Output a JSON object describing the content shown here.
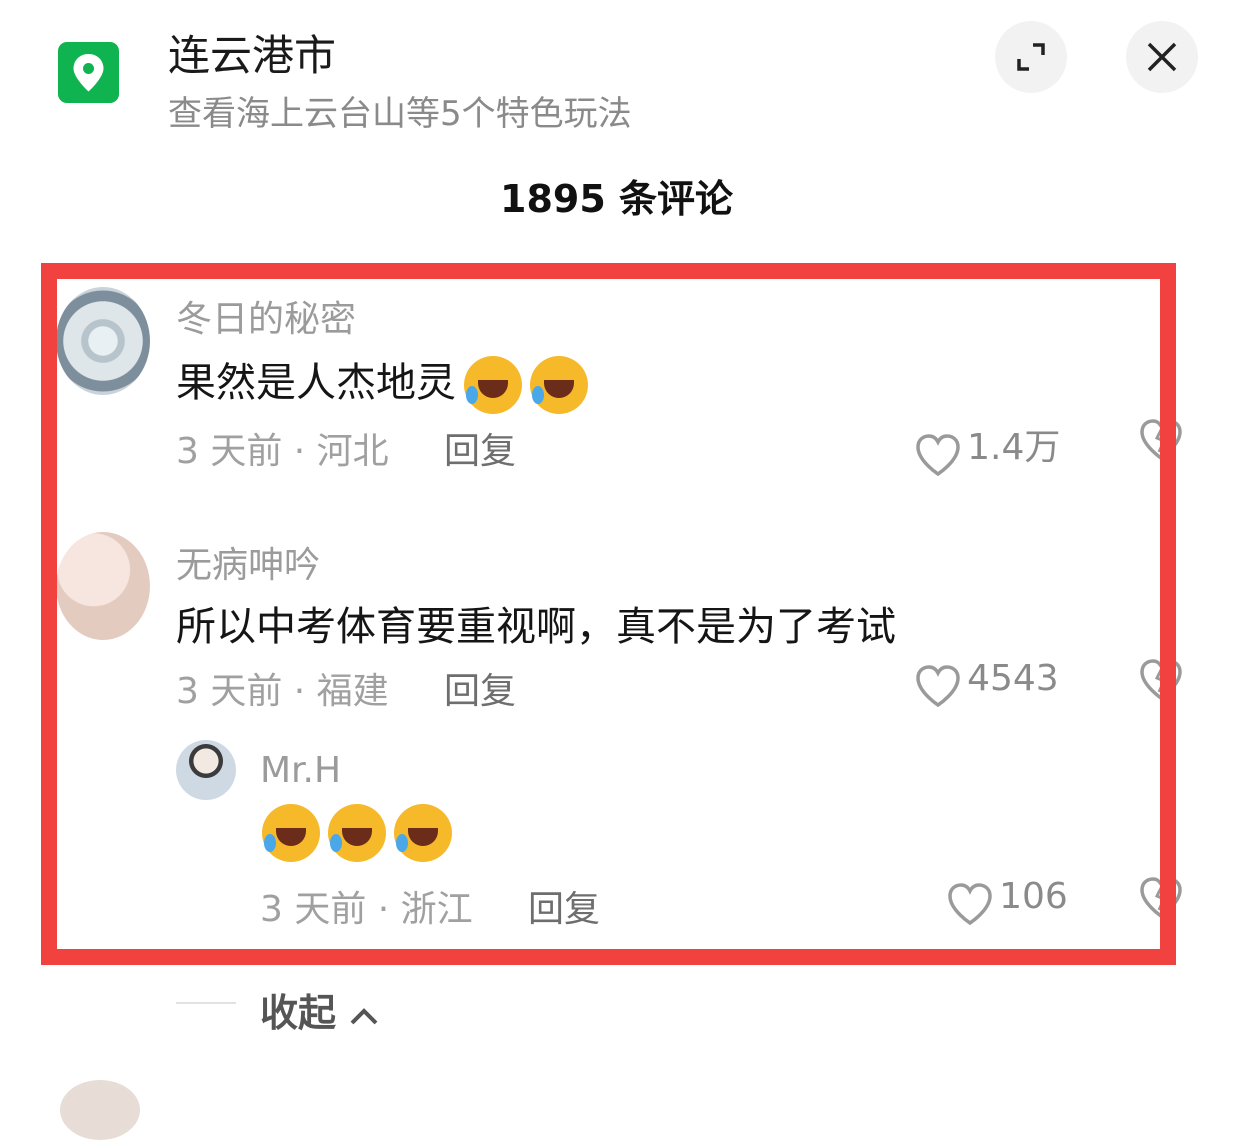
{
  "location": {
    "title": "连云港市",
    "subtitle": "查看海上云台山等5个特色玩法"
  },
  "comments_header": {
    "count_text": "1895 条评论"
  },
  "comments": [
    {
      "username": "冬日的秘密",
      "text": "果然是人杰地灵",
      "emoji_count": 2,
      "meta": "3 天前 · 河北",
      "reply_label": "回复",
      "likes": "1.4万"
    },
    {
      "username": "无病呻吟",
      "text": "所以中考体育要重视啊，真不是为了考试",
      "meta": "3 天前 · 福建",
      "reply_label": "回复",
      "likes": "4543",
      "replies": [
        {
          "username": "Mr.H",
          "emoji_count": 3,
          "meta": "3 天前 · 浙江",
          "reply_label": "回复",
          "likes": "106"
        }
      ]
    }
  ],
  "collapse_label": "收起",
  "colors": {
    "highlight_frame": "#f2423f",
    "location_icon": "#0fb34f"
  },
  "icons": [
    "location-pin-icon",
    "expand-icon",
    "close-icon",
    "heart-icon",
    "dislike-icon",
    "chevron-up-icon",
    "laughing-crying-emoji"
  ]
}
